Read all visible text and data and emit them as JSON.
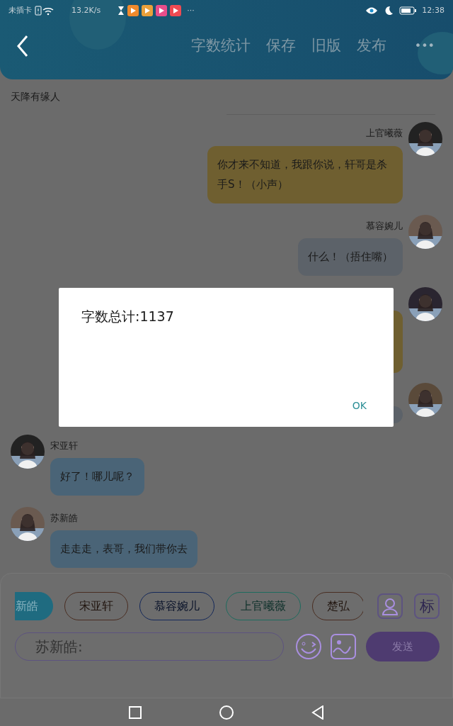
{
  "status_bar": {
    "carrier": "未插卡",
    "speed": "13.2K/s",
    "more": "···",
    "time": "12:38"
  },
  "toolbar": {
    "actions": [
      "字数统计",
      "保存",
      "旧版",
      "发布"
    ],
    "more": "•••"
  },
  "chat": {
    "title": "天降有缘人",
    "messages": [
      {
        "kind": "outgoing",
        "sender": "上官曦薇",
        "text": "你才来不知道，我跟你说，轩哥是杀手S！（小声）",
        "color": "#6f5f30"
      },
      {
        "kind": "outgoing",
        "sender": "慕容婉儿",
        "text": "什么！（捂住嘴）",
        "color": "#5c6269"
      },
      {
        "kind": "outgoing",
        "color": "#6f5f30"
      },
      {
        "kind": "outgoing",
        "color": "#5c6269"
      },
      {
        "kind": "incoming",
        "sender": "宋亚轩",
        "text": "好了！哪儿呢？",
        "color": "#4a6477"
      },
      {
        "kind": "incoming",
        "sender": "苏新皓",
        "text": "走走走，表哥，我们带你去",
        "color": "#4a6477"
      }
    ]
  },
  "composer": {
    "roles": [
      {
        "label": "新皓",
        "selected": true,
        "color": "#1f6b80"
      },
      {
        "label": "宋亚轩",
        "selected": false,
        "color": "#4a2e22"
      },
      {
        "label": "慕容婉儿",
        "selected": false,
        "color": "#14285a"
      },
      {
        "label": "上官曦薇",
        "selected": false,
        "color": "#1d6b5e"
      },
      {
        "label": "楚弘",
        "selected": false,
        "color": "#4a2e22"
      }
    ],
    "tag_button": "标",
    "input_value": "苏新皓:",
    "send": "发送"
  },
  "dialog": {
    "message": "字数总计:1137",
    "ok": "OK"
  }
}
